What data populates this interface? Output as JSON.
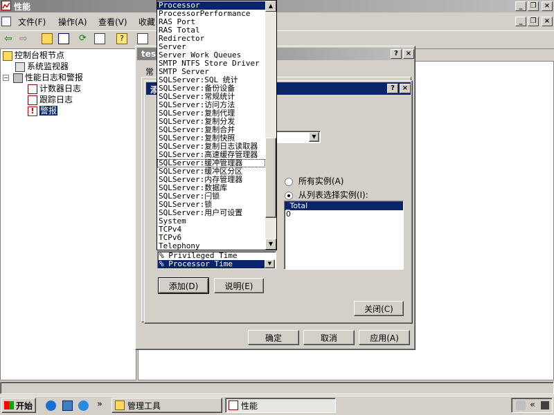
{
  "window": {
    "title": "性能"
  },
  "menu": {
    "items": [
      "文件(F)",
      "操作(A)",
      "查看(V)",
      "收藏"
    ]
  },
  "tree": {
    "root": "控制台根节点",
    "monitor": "系统监视器",
    "logs": "性能日志和警报",
    "counter_logs": "计数器日志",
    "trace_logs": "跟踪日志",
    "alerts": "警报"
  },
  "props_dialog": {
    "title_partial": "tes",
    "tab_partial": "常",
    "ok": "确定",
    "cancel": "取消",
    "apply": "应用(A)"
  },
  "add_dialog": {
    "title_partial": "添",
    "radio_all": "所有实例(A)",
    "radio_list": "从列表选择实例(I):",
    "instances": [
      "_Total",
      "0"
    ],
    "counters": [
      "% Privileged Time",
      "% Processor Time"
    ],
    "add": "添加(D)",
    "explain": "说明(E)",
    "close": "关闭(C)"
  },
  "object_list": {
    "items": [
      "Processor",
      "ProcessorPerformance",
      "RAS Port",
      "RAS Total",
      "Redirector",
      "Server",
      "Server Work Queues",
      "SMTP NTFS Store Driver",
      "SMTP Server",
      "SQLServer:SQL 统计",
      "SQLServer:备份设备",
      "SQLServer:常规统计",
      "SQLServer:访问方法",
      "SQLServer:复制代理",
      "SQLServer:复制分发",
      "SQLServer:复制合并",
      "SQLServer:复制快照",
      "SQLServer:复制日志读取器",
      "SQLServer:高速缓存管理器",
      "SQLServer:缓冲管理器",
      "SQLServer:缓冲区分区",
      "SQLServer:内存管理器",
      "SQLServer:数据库",
      "SQLServer:闩锁",
      "SQLServer:锁",
      "SQLServer:用户可设置",
      "System",
      "TCPv4",
      "TCPv6",
      "Telephony"
    ],
    "selected_index": 0,
    "focused_index": 19
  },
  "taskbar": {
    "start": "开始",
    "task1": "管理工具",
    "task2": "性能",
    "chevron": "»",
    "tray_arrows": "«"
  },
  "colors": {
    "titlebar": "#0a246a",
    "selection": "#0a246a",
    "face": "#d4d0c8"
  }
}
